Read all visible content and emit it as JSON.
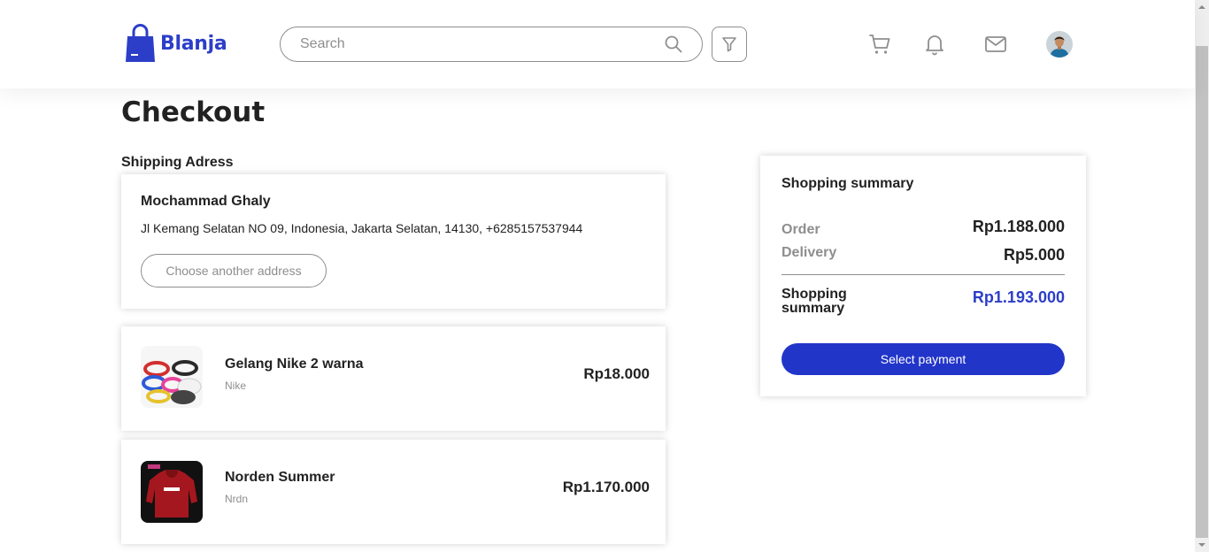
{
  "header": {
    "logo_text": "Blanja",
    "search_placeholder": "Search",
    "icons": [
      "shopping-bag-icon",
      "search-icon",
      "filter-icon",
      "cart-icon",
      "bell-icon",
      "mail-icon"
    ]
  },
  "main": {
    "title": "Checkout",
    "shipping_label": "Shipping Adress",
    "address": {
      "name": "Mochammad Ghaly",
      "line": "Jl Kemang Selatan NO 09, Indonesia, Jakarta Selatan, 14130, +6285157537944",
      "button": "Choose another address"
    },
    "products": [
      {
        "name": "Gelang Nike 2 warna",
        "brand": "Nike",
        "price": "Rp18.000"
      },
      {
        "name": "Norden Summer",
        "brand": "Nrdn",
        "price": "Rp1.170.000"
      }
    ]
  },
  "summary": {
    "title": "Shopping summary",
    "order_label": "Order",
    "order_value": "Rp1.188.000",
    "delivery_label": "Delivery",
    "delivery_value": "Rp5.000",
    "total_label": "Shopping summary",
    "total_value": "Rp1.193.000",
    "pay_button": "Select payment"
  },
  "colors": {
    "brand": "#2c3ec8",
    "button": "#2235c9",
    "muted": "#8e8e8e"
  }
}
